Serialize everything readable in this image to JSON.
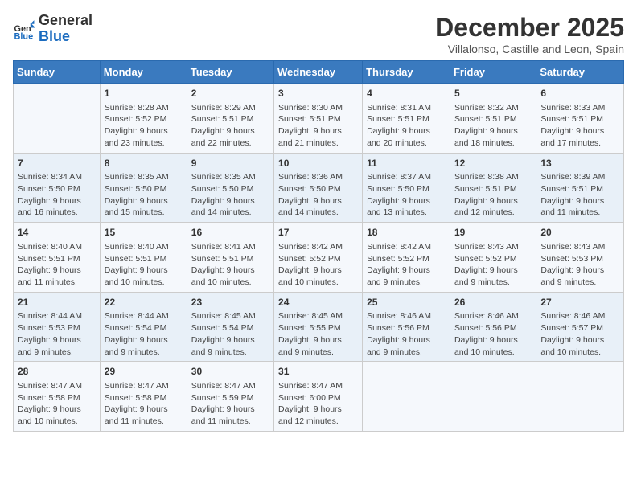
{
  "logo": {
    "line1": "General",
    "line2": "Blue"
  },
  "title": "December 2025",
  "location": "Villalonso, Castille and Leon, Spain",
  "weekdays": [
    "Sunday",
    "Monday",
    "Tuesday",
    "Wednesday",
    "Thursday",
    "Friday",
    "Saturday"
  ],
  "rows": [
    [
      {
        "day": "",
        "sunrise": "",
        "sunset": "",
        "daylight": ""
      },
      {
        "day": "1",
        "sunrise": "8:28 AM",
        "sunset": "5:52 PM",
        "daylight": "9 hours and 23 minutes."
      },
      {
        "day": "2",
        "sunrise": "8:29 AM",
        "sunset": "5:51 PM",
        "daylight": "9 hours and 22 minutes."
      },
      {
        "day": "3",
        "sunrise": "8:30 AM",
        "sunset": "5:51 PM",
        "daylight": "9 hours and 21 minutes."
      },
      {
        "day": "4",
        "sunrise": "8:31 AM",
        "sunset": "5:51 PM",
        "daylight": "9 hours and 20 minutes."
      },
      {
        "day": "5",
        "sunrise": "8:32 AM",
        "sunset": "5:51 PM",
        "daylight": "9 hours and 18 minutes."
      },
      {
        "day": "6",
        "sunrise": "8:33 AM",
        "sunset": "5:51 PM",
        "daylight": "9 hours and 17 minutes."
      }
    ],
    [
      {
        "day": "7",
        "sunrise": "8:34 AM",
        "sunset": "5:50 PM",
        "daylight": "9 hours and 16 minutes."
      },
      {
        "day": "8",
        "sunrise": "8:35 AM",
        "sunset": "5:50 PM",
        "daylight": "9 hours and 15 minutes."
      },
      {
        "day": "9",
        "sunrise": "8:35 AM",
        "sunset": "5:50 PM",
        "daylight": "9 hours and 14 minutes."
      },
      {
        "day": "10",
        "sunrise": "8:36 AM",
        "sunset": "5:50 PM",
        "daylight": "9 hours and 14 minutes."
      },
      {
        "day": "11",
        "sunrise": "8:37 AM",
        "sunset": "5:50 PM",
        "daylight": "9 hours and 13 minutes."
      },
      {
        "day": "12",
        "sunrise": "8:38 AM",
        "sunset": "5:51 PM",
        "daylight": "9 hours and 12 minutes."
      },
      {
        "day": "13",
        "sunrise": "8:39 AM",
        "sunset": "5:51 PM",
        "daylight": "9 hours and 11 minutes."
      }
    ],
    [
      {
        "day": "14",
        "sunrise": "8:40 AM",
        "sunset": "5:51 PM",
        "daylight": "9 hours and 11 minutes."
      },
      {
        "day": "15",
        "sunrise": "8:40 AM",
        "sunset": "5:51 PM",
        "daylight": "9 hours and 10 minutes."
      },
      {
        "day": "16",
        "sunrise": "8:41 AM",
        "sunset": "5:51 PM",
        "daylight": "9 hours and 10 minutes."
      },
      {
        "day": "17",
        "sunrise": "8:42 AM",
        "sunset": "5:52 PM",
        "daylight": "9 hours and 10 minutes."
      },
      {
        "day": "18",
        "sunrise": "8:42 AM",
        "sunset": "5:52 PM",
        "daylight": "9 hours and 9 minutes."
      },
      {
        "day": "19",
        "sunrise": "8:43 AM",
        "sunset": "5:52 PM",
        "daylight": "9 hours and 9 minutes."
      },
      {
        "day": "20",
        "sunrise": "8:43 AM",
        "sunset": "5:53 PM",
        "daylight": "9 hours and 9 minutes."
      }
    ],
    [
      {
        "day": "21",
        "sunrise": "8:44 AM",
        "sunset": "5:53 PM",
        "daylight": "9 hours and 9 minutes."
      },
      {
        "day": "22",
        "sunrise": "8:44 AM",
        "sunset": "5:54 PM",
        "daylight": "9 hours and 9 minutes."
      },
      {
        "day": "23",
        "sunrise": "8:45 AM",
        "sunset": "5:54 PM",
        "daylight": "9 hours and 9 minutes."
      },
      {
        "day": "24",
        "sunrise": "8:45 AM",
        "sunset": "5:55 PM",
        "daylight": "9 hours and 9 minutes."
      },
      {
        "day": "25",
        "sunrise": "8:46 AM",
        "sunset": "5:56 PM",
        "daylight": "9 hours and 9 minutes."
      },
      {
        "day": "26",
        "sunrise": "8:46 AM",
        "sunset": "5:56 PM",
        "daylight": "9 hours and 10 minutes."
      },
      {
        "day": "27",
        "sunrise": "8:46 AM",
        "sunset": "5:57 PM",
        "daylight": "9 hours and 10 minutes."
      }
    ],
    [
      {
        "day": "28",
        "sunrise": "8:47 AM",
        "sunset": "5:58 PM",
        "daylight": "9 hours and 10 minutes."
      },
      {
        "day": "29",
        "sunrise": "8:47 AM",
        "sunset": "5:58 PM",
        "daylight": "9 hours and 11 minutes."
      },
      {
        "day": "30",
        "sunrise": "8:47 AM",
        "sunset": "5:59 PM",
        "daylight": "9 hours and 11 minutes."
      },
      {
        "day": "31",
        "sunrise": "8:47 AM",
        "sunset": "6:00 PM",
        "daylight": "9 hours and 12 minutes."
      },
      {
        "day": "",
        "sunrise": "",
        "sunset": "",
        "daylight": ""
      },
      {
        "day": "",
        "sunrise": "",
        "sunset": "",
        "daylight": ""
      },
      {
        "day": "",
        "sunrise": "",
        "sunset": "",
        "daylight": ""
      }
    ]
  ]
}
